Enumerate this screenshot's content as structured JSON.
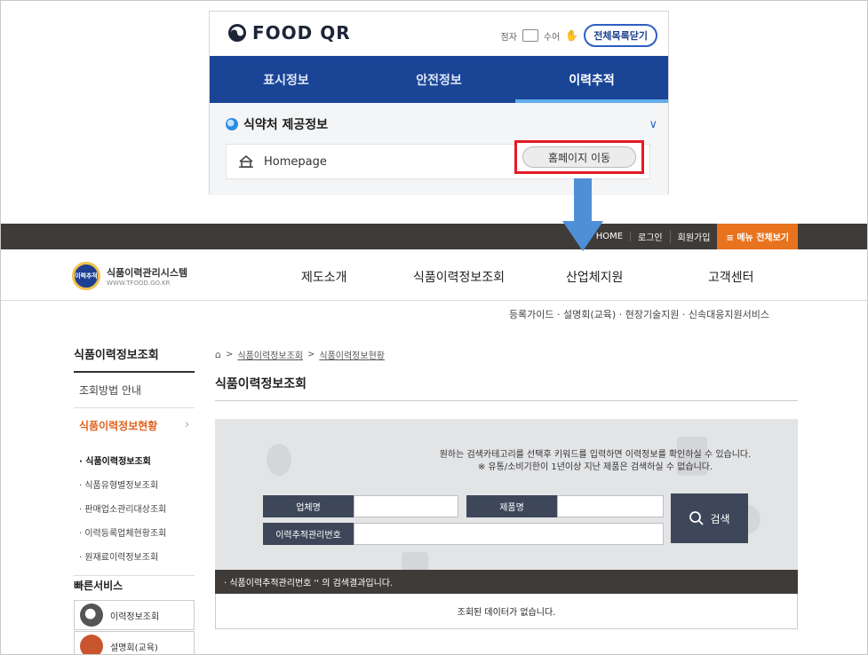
{
  "food_qr": {
    "logo_text": "FOOD QR",
    "util_braille": "점자",
    "util_sign": "수어",
    "close_all_label": "전체목록닫기",
    "tabs": [
      {
        "label": "표시정보",
        "active": false
      },
      {
        "label": "안전정보",
        "active": false
      },
      {
        "label": "이력추적",
        "active": true
      }
    ],
    "provider_title": "식약처 제공정보",
    "homepage_label": "Homepage",
    "homepage_button": "홈페이지 이동",
    "colors": {
      "tab_bar": "#1a4597",
      "highlight": "#e31b23",
      "arrow": "#4f8fd6"
    }
  },
  "site": {
    "top_links": [
      "HOME",
      "로그인",
      "회원가입"
    ],
    "menu_all": "≡ 메뉴 전체보기",
    "logo_mark": "이력추적",
    "logo_name": "식품이력관리시스템",
    "logo_url": "WWW.TFOOD.GO.KR",
    "gnb": [
      "제도소개",
      "식품이력정보조회",
      "산업체지원",
      "고객센터"
    ],
    "sub_links": "등록가이드 · 설명회(교육) · 현장기술지원 · 신속대응지원서비스"
  },
  "lnb": {
    "title": "식품이력정보조회",
    "items": [
      "조회방법 안내",
      "식품이력정보현황"
    ],
    "active_chevron": "›",
    "sub_items": [
      "· 식품이력정보조회",
      "· 식품유형별정보조회",
      "· 판매업소관리대상조회",
      "· 이력등록업체현황조회",
      "· 원재료이력정보조회"
    ],
    "quick_title": "빠른서비스",
    "quick_items": [
      "이력정보조회",
      "설명회(교육)"
    ]
  },
  "content": {
    "breadcrumb": [
      "식품이력정보조회",
      "식품이력정보현황"
    ],
    "page_title": "식품이력정보조회",
    "notice_line1": "원하는 검색카테고리를 선택후 키워드를 입력하면 이력정보를 확인하실 수 있습니다.",
    "notice_line2": "※ 유통/소비기한이 1년이상 지난 제품은 검색하실 수 없습니다.",
    "field_company": "업체명",
    "field_product": "제품명",
    "field_trace_no": "이력추적관리번호",
    "search_button": "검색",
    "result_bar": "· 식품이력추적관리번호 '' 의 검색결과입니다.",
    "no_data": "조회된 데이터가 없습니다."
  }
}
